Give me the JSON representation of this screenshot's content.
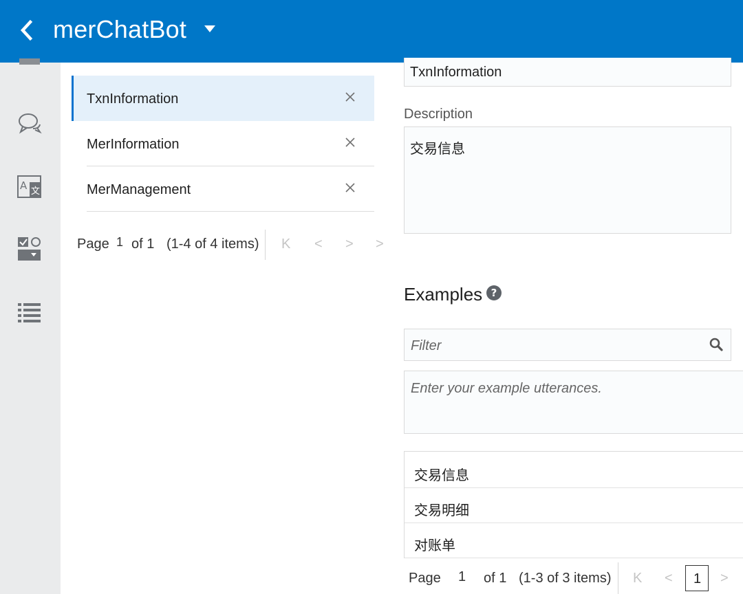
{
  "header": {
    "app_title": "merChatBot",
    "back_icon": "chevron-left-icon",
    "caret_icon": "caret-down-icon",
    "color": "#0077c8"
  },
  "left_rail": {
    "items": [
      {
        "name": "intents",
        "icon": "menu-bar-icon"
      },
      {
        "name": "entities",
        "icon": "chat-bubbles-icon"
      },
      {
        "name": "resource-bundles",
        "icon": "translate-icon"
      },
      {
        "name": "flows",
        "icon": "checkbox-form-icon"
      },
      {
        "name": "list",
        "icon": "list-icon"
      }
    ]
  },
  "intents": {
    "items": [
      {
        "label": "TxnInformation",
        "selected": true
      },
      {
        "label": "MerInformation",
        "selected": false
      },
      {
        "label": "MerManagement",
        "selected": false
      }
    ],
    "pager": {
      "page_label": "Page",
      "page_value": "1",
      "of_text": "of 1",
      "range_text": "(1-4 of 4 items)"
    }
  },
  "detail": {
    "name_value": "TxnInformation",
    "description_label": "Description",
    "description_value": "交易信息",
    "examples_title": "Examples",
    "help_icon": "help-circle-icon",
    "filter_placeholder": "Filter",
    "search_icon": "search-icon",
    "utterance_placeholder": "Enter your example utterances.",
    "utterances": [
      "交易信息",
      "交易明细",
      "对账单"
    ],
    "pager": {
      "page_label": "Page",
      "page_value": "1",
      "of_text": "of 1",
      "range_text": "(1-3 of 3 items)",
      "current_page": "1"
    }
  },
  "colors": {
    "accent": "#0572ce",
    "selected_bg": "#e4f0fa",
    "rail_bg": "#eaebec"
  }
}
